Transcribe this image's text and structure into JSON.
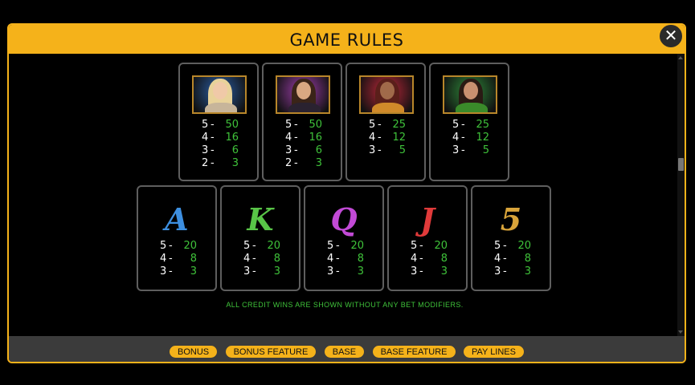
{
  "dialog": {
    "title": "GAME RULES",
    "close_label": "✕"
  },
  "portrait_symbols": [
    {
      "name": "blonde-woman",
      "frame": "#b8862a",
      "bg": "#2a5fa8",
      "hair": "#e8d29a",
      "skin": "#f0c9a8",
      "outfit": "#c7b59a",
      "pays": [
        {
          "count": "5",
          "value": "50"
        },
        {
          "count": "4",
          "value": "16"
        },
        {
          "count": "3",
          "value": "6"
        },
        {
          "count": "2",
          "value": "3"
        }
      ]
    },
    {
      "name": "brunette-woman",
      "frame": "#b8862a",
      "bg": "#a23fb0",
      "hair": "#3a2418",
      "skin": "#d9a882",
      "outfit": "#2a2230",
      "pays": [
        {
          "count": "5",
          "value": "50"
        },
        {
          "count": "4",
          "value": "16"
        },
        {
          "count": "3",
          "value": "6"
        },
        {
          "count": "2",
          "value": "3"
        }
      ]
    },
    {
      "name": "redhead-woman",
      "frame": "#b8862a",
      "bg": "#c0283a",
      "hair": "#5a1f1a",
      "skin": "#a06a4a",
      "outfit": "#d08a2a",
      "pays": [
        {
          "count": "5",
          "value": "25"
        },
        {
          "count": "4",
          "value": "12"
        },
        {
          "count": "3",
          "value": "5"
        }
      ]
    },
    {
      "name": "green-dress-woman",
      "frame": "#b8862a",
      "bg": "#2f8a3a",
      "hair": "#2a1a14",
      "skin": "#c89070",
      "outfit": "#3a8a2a",
      "pays": [
        {
          "count": "5",
          "value": "25"
        },
        {
          "count": "4",
          "value": "12"
        },
        {
          "count": "3",
          "value": "5"
        }
      ]
    }
  ],
  "letter_symbols": [
    {
      "glyph": "A",
      "color": "#3d8fe0",
      "pays": [
        {
          "count": "5",
          "value": "20"
        },
        {
          "count": "4",
          "value": "8"
        },
        {
          "count": "3",
          "value": "3"
        }
      ]
    },
    {
      "glyph": "K",
      "color": "#58c447",
      "pays": [
        {
          "count": "5",
          "value": "20"
        },
        {
          "count": "4",
          "value": "8"
        },
        {
          "count": "3",
          "value": "3"
        }
      ]
    },
    {
      "glyph": "Q",
      "color": "#c24ad6",
      "pays": [
        {
          "count": "5",
          "value": "20"
        },
        {
          "count": "4",
          "value": "8"
        },
        {
          "count": "3",
          "value": "3"
        }
      ]
    },
    {
      "glyph": "J",
      "color": "#e03a3a",
      "pays": [
        {
          "count": "5",
          "value": "20"
        },
        {
          "count": "4",
          "value": "8"
        },
        {
          "count": "3",
          "value": "3"
        }
      ]
    },
    {
      "glyph": "5",
      "color": "#d9a43a",
      "pays": [
        {
          "count": "5",
          "value": "20"
        },
        {
          "count": "4",
          "value": "8"
        },
        {
          "count": "3",
          "value": "3"
        }
      ]
    }
  ],
  "note": "ALL CREDIT WINS ARE SHOWN WITHOUT ANY BET MODIFIERS.",
  "footer": {
    "buttons": [
      {
        "label": "BONUS"
      },
      {
        "label": "BONUS FEATURE"
      },
      {
        "label": "BASE"
      },
      {
        "label": "BASE FEATURE"
      },
      {
        "label": "PAY LINES"
      }
    ]
  }
}
